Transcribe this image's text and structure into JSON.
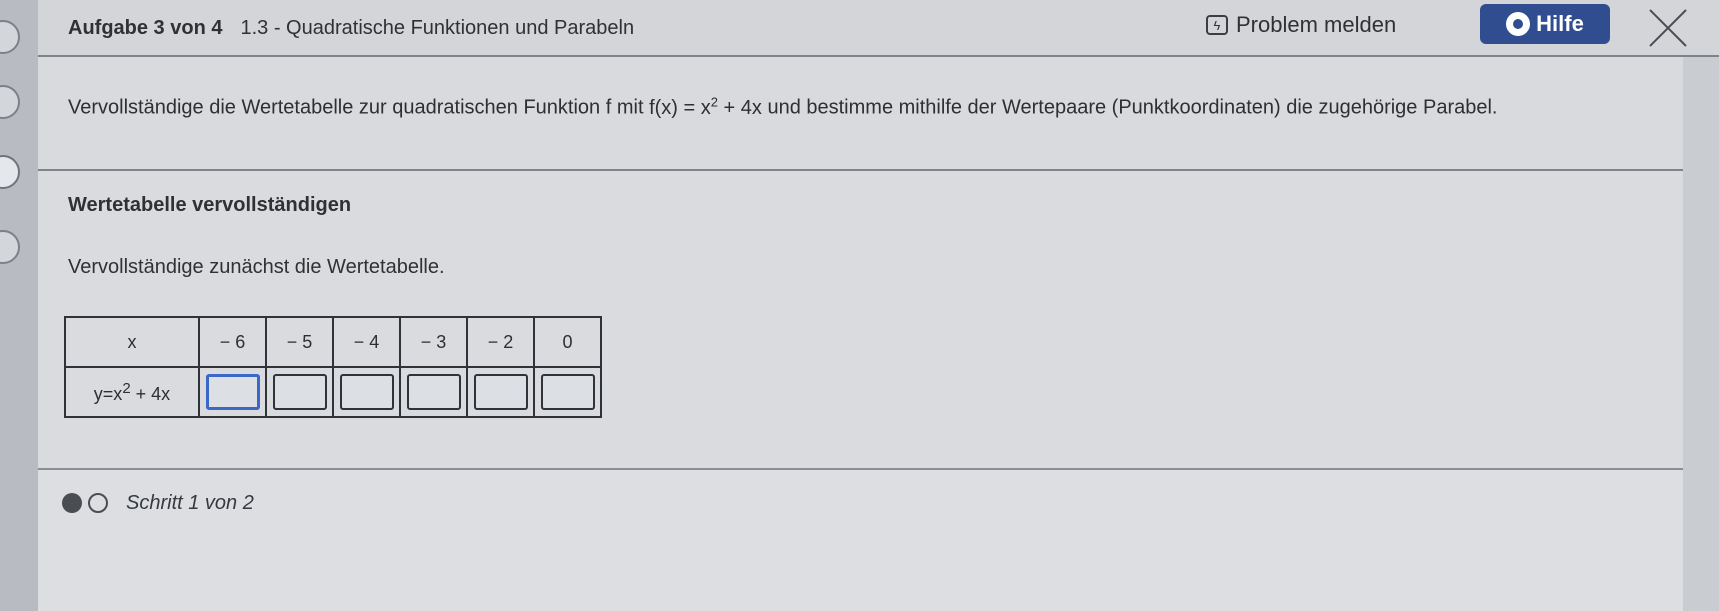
{
  "header": {
    "task_counter": "Aufgabe 3 von 4",
    "task_title": "1.3 - Quadratische Funktionen und Parabeln",
    "problem_label": "Problem melden",
    "help_label": "Hilfe"
  },
  "task": {
    "text_before": "Vervollständige die Wertetabelle zur quadratischen Funktion f mit ",
    "formula_prefix": "f(x) = x",
    "formula_exp": "2",
    "formula_suffix": " + 4x",
    "text_after": " und bestimme mithilfe der Wertepaare (Punktkoordinaten) die zugehörige Parabel."
  },
  "section": {
    "heading": "Wertetabelle vervollständigen",
    "instruction": "Vervollständige zunächst die Wertetabelle."
  },
  "table": {
    "x_header": "x",
    "x_values": [
      "− 6",
      "− 5",
      "− 4",
      "− 3",
      "− 2",
      "0"
    ],
    "y_header_prefix": "y=x",
    "y_header_exp": "2",
    "y_header_suffix": " + 4x",
    "y_values": [
      "",
      "",
      "",
      "",
      "",
      ""
    ]
  },
  "footer": {
    "step_label": "Schritt 1 von 2"
  },
  "colors": {
    "help_button": "#2f4d8f",
    "focus_border": "#3b67c9"
  }
}
